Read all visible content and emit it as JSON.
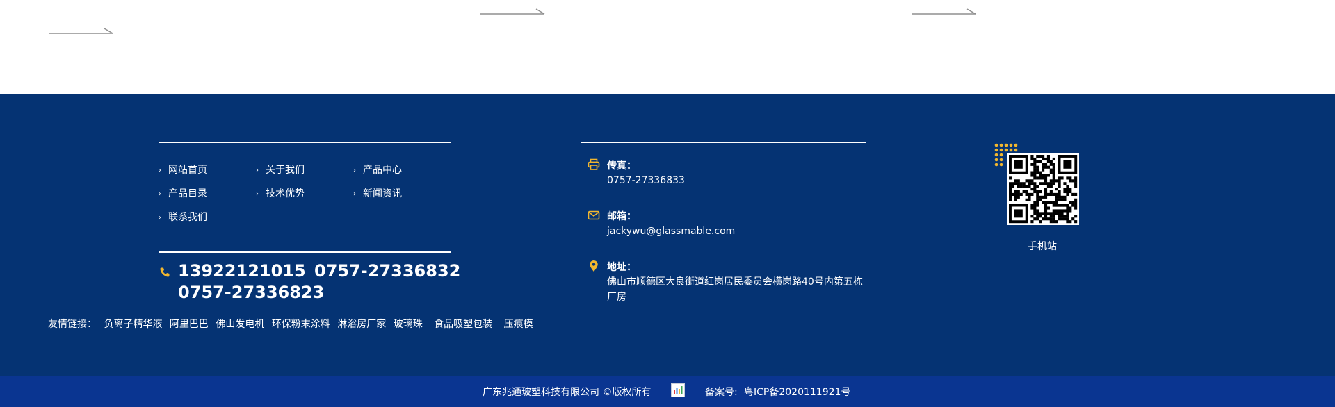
{
  "nav": {
    "items": [
      {
        "label": "网站首页"
      },
      {
        "label": "关于我们"
      },
      {
        "label": "产品中心"
      },
      {
        "label": "产品目录"
      },
      {
        "label": "技术优势"
      },
      {
        "label": "新闻资讯"
      },
      {
        "label": "联系我们"
      }
    ]
  },
  "contact": {
    "phone_1": "13922121015",
    "phone_2": "0757-27336832",
    "phone_3": "0757-27336823",
    "fax_label": "传真：",
    "fax_value": "0757-27336833",
    "email_label": "邮箱：",
    "email_value": "jackywu@glassmable.com",
    "address_label": "地址：",
    "address_line_1": "佛山市顺德区大良街道红岗居民委员会横岗路40号内第五栋",
    "address_line_2": "厂房"
  },
  "friend_links": {
    "label": "友情链接：",
    "items": [
      "负离子精华液",
      "阿里巴巴",
      "佛山发电机",
      "环保粉末涂料",
      "淋浴房厂家",
      "玻璃珠",
      "食品吸塑包装",
      "压痕模"
    ]
  },
  "qr": {
    "caption": "手机站"
  },
  "footer_bottom": {
    "copyright": "广东兆通玻塑科技有限公司 ©版权所有",
    "icp_label": "备案号:",
    "icp_value": "粤ICP备2020111921号"
  },
  "colors": {
    "footer_bg": "#053373",
    "bottom_bg": "#0a3591",
    "accent": "#f2b72f"
  }
}
